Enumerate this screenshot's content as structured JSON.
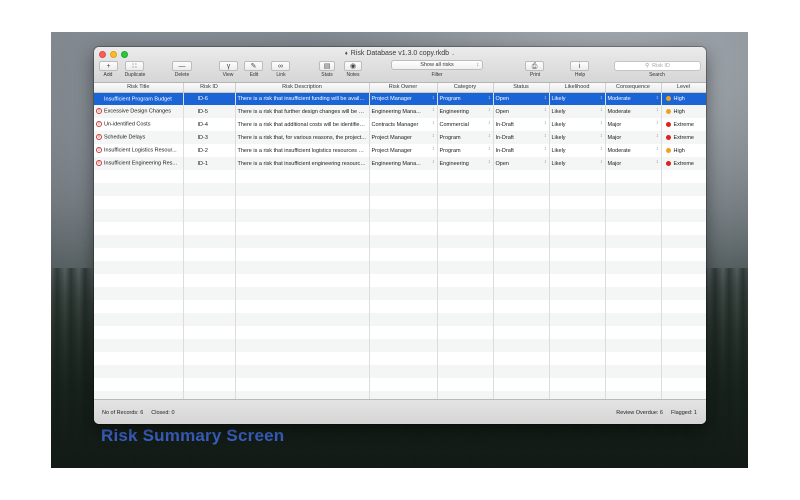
{
  "window": {
    "title": "Risk Database  v1.3.0 copy.rkdb",
    "caption": "Risk Summary Screen"
  },
  "toolbar": {
    "add_label": "Add",
    "duplicate_label": "Duplicate",
    "delete_label": "Delete",
    "view_label": "View",
    "edit_label": "Edit",
    "link_label": "Link",
    "stats_label": "Stats",
    "notes_label": "Notes",
    "filter_label": "Filter",
    "filter_value": "Show all risks",
    "print_label": "Print",
    "help_label": "Help",
    "search_label": "Search",
    "search_placeholder": "Risk ID"
  },
  "table": {
    "columns": [
      "Risk Title",
      "Risk ID",
      "Risk Description",
      "Risk Owner",
      "Category",
      "Status",
      "Likelihood",
      "Consequence",
      "Level"
    ],
    "rows": [
      {
        "title": "Insufficient Program Budget",
        "id": "ID-6",
        "desc": "There is a risk that insufficient funding will be availa...",
        "owner": "Project Manager",
        "category": "Program",
        "status": "Open",
        "likelihood": "Likely",
        "consequence": "Moderate",
        "level": "High",
        "level_color": "#f0a020",
        "selected": true
      },
      {
        "title": "Excessive Design Changes",
        "id": "ID-5",
        "desc": "There is a risk that further design changes will be pr...",
        "owner": "Engineering Mana...",
        "category": "Engineering",
        "status": "Open",
        "likelihood": "Likely",
        "consequence": "Moderate",
        "level": "High",
        "level_color": "#f0a020",
        "selected": false
      },
      {
        "title": "Un-identified Costs",
        "id": "ID-4",
        "desc": "There is a risk that additional costs will be identified...",
        "owner": "Contracts Manager",
        "category": "Commercial",
        "status": "In-Draft",
        "likelihood": "Likely",
        "consequence": "Major",
        "level": "Extreme",
        "level_color": "#e02020",
        "selected": false
      },
      {
        "title": "Schedule Delays",
        "id": "ID-3",
        "desc": "There is a risk that, for various reasons, the project...",
        "owner": "Project Manager",
        "category": "Program",
        "status": "In-Draft",
        "likelihood": "Likely",
        "consequence": "Major",
        "level": "Extreme",
        "level_color": "#e02020",
        "selected": false
      },
      {
        "title": "Insufficient Logistics Resour...",
        "id": "ID-2",
        "desc": "There is a risk that insufficient logistics resources wi...",
        "owner": "Project Manager",
        "category": "Program",
        "status": "In-Draft",
        "likelihood": "Likely",
        "consequence": "Moderate",
        "level": "High",
        "level_color": "#f0a020",
        "selected": false
      },
      {
        "title": "Insufficient Engineering Res...",
        "id": "ID-1",
        "desc": "There is a risk that insufficient engineering resource...",
        "owner": "Engineering Mana...",
        "category": "Engineering",
        "status": "Open",
        "likelihood": "Likely",
        "consequence": "Major",
        "level": "Extreme",
        "level_color": "#e02020",
        "selected": false
      }
    ]
  },
  "statusbar": {
    "records": "No of Records: 6",
    "closed": "Closed: 0",
    "review_overdue": "Review Overdue: 6",
    "flagged": "Flagged: 1"
  }
}
